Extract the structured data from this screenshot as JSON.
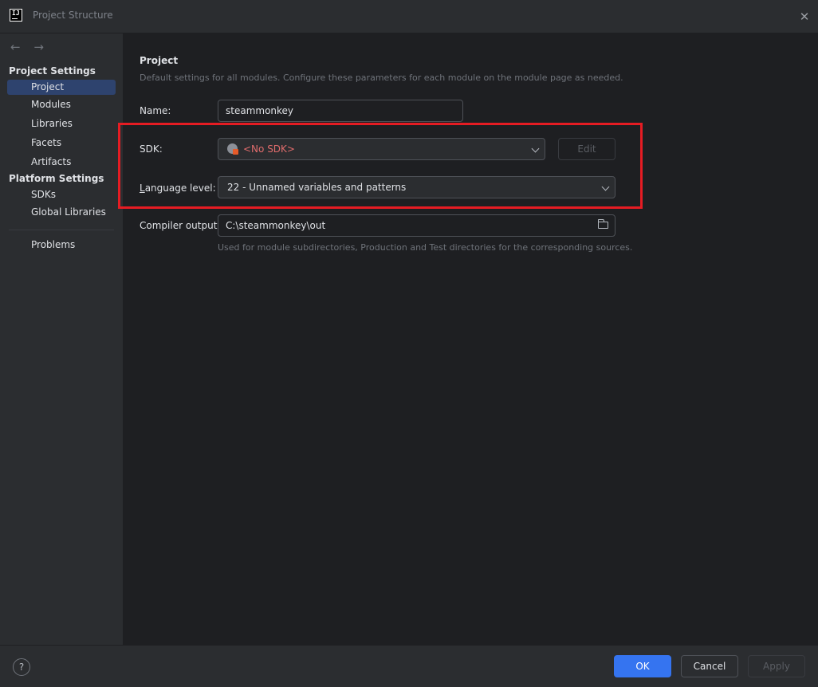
{
  "window": {
    "title": "Project Structure",
    "logo": "IJ"
  },
  "sidebar": {
    "nav_back": "←",
    "nav_forward": "→",
    "project_settings_title": "Project Settings",
    "project_settings_items": [
      "Project",
      "Modules",
      "Libraries",
      "Facets",
      "Artifacts"
    ],
    "platform_settings_title": "Platform Settings",
    "platform_settings_items": [
      "SDKs",
      "Global Libraries"
    ],
    "problems": "Problems",
    "selected": "Project"
  },
  "main": {
    "title": "Project",
    "description": "Default settings for all modules. Configure these parameters for each module on the module page as needed.",
    "name_label": "Name:",
    "name_value": "steammonkey",
    "sdk_label": "SDK:",
    "sdk_value": "<No SDK>",
    "sdk_edit_label": "Edit",
    "language_level_label": "Language level:",
    "language_level_value": "22 - Unnamed variables and patterns",
    "compiler_output_label": "Compiler output:",
    "compiler_output_value": "C:\\steammonkey\\out",
    "compiler_output_hint": "Used for module subdirectories, Production and Test directories for the corresponding sources."
  },
  "footer": {
    "help": "?",
    "ok": "OK",
    "cancel": "Cancel",
    "apply": "Apply"
  },
  "colors": {
    "accent": "#3574f0",
    "selection": "#2e436e",
    "error_text": "#e06c6c",
    "highlight_box": "#e51c23"
  },
  "icons": {
    "sdk": "globe-warning-icon",
    "dropdown": "chevron-down-icon",
    "folder": "folder-icon",
    "close": "close-icon",
    "help": "help-icon"
  }
}
